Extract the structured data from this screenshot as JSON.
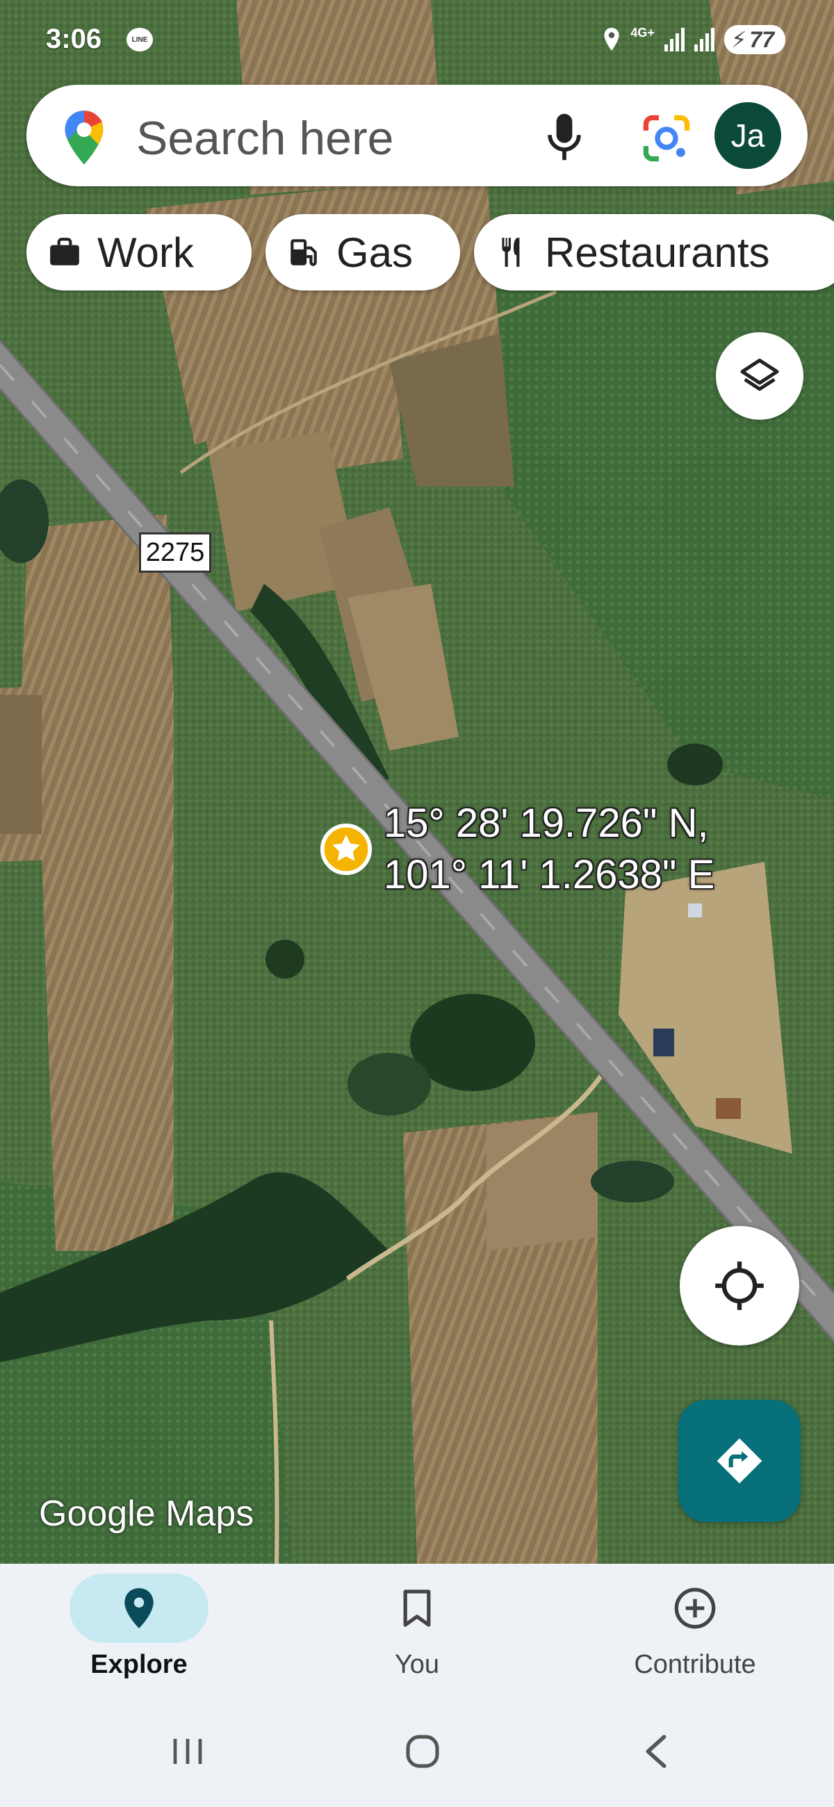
{
  "status_bar": {
    "time": "3:06",
    "notification_app": "LINE",
    "network": "4G+",
    "battery": "77"
  },
  "search": {
    "placeholder": "Search here",
    "avatar_initials": "Ja"
  },
  "chips": [
    {
      "label": "Work",
      "icon": "briefcase-icon"
    },
    {
      "label": "Gas",
      "icon": "gas-station-icon"
    },
    {
      "label": "Restaurants",
      "icon": "fork-knife-icon"
    }
  ],
  "map": {
    "road_number": "2275",
    "pin_coords_line1": "15° 28' 19.726\" N,",
    "pin_coords_line2": "101° 11' 1.2638\" E",
    "watermark": "Google Maps"
  },
  "bottom_nav": {
    "tabs": [
      {
        "label": "Explore",
        "icon": "location-pin-icon",
        "active": true
      },
      {
        "label": "You",
        "icon": "bookmark-icon",
        "active": false
      },
      {
        "label": "Contribute",
        "icon": "add-circle-icon",
        "active": false
      }
    ]
  },
  "colors": {
    "accent": "#07707a",
    "active_tab_bg": "#c7eaf2",
    "avatar_bg": "#0b4a3a",
    "pin": "#f4b400"
  }
}
